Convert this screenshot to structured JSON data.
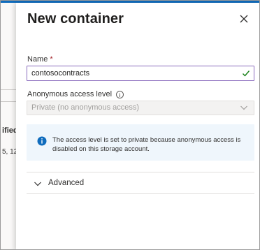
{
  "background": {
    "text1": "ified",
    "text2": "5, 12"
  },
  "panel": {
    "title": "New container",
    "close_icon": "close-icon"
  },
  "name_field": {
    "label": "Name",
    "required_mark": "*",
    "value": "contosocontracts",
    "valid_icon": "checkmark-icon"
  },
  "access_field": {
    "label": "Anonymous access level",
    "info_icon": "info-icon",
    "selected": "Private (no anonymous access)",
    "disabled": true
  },
  "info_message": {
    "icon": "info-filled-icon",
    "text": "The access level is set to private because anonymous access is disabled on this storage account."
  },
  "advanced": {
    "label": "Advanced",
    "expanded": false
  },
  "colors": {
    "accent": "#0f6cbd",
    "input_border": "#8a6bbd",
    "valid": "#107c10",
    "info_bg": "#eff6fc",
    "required": "#a4262c"
  }
}
